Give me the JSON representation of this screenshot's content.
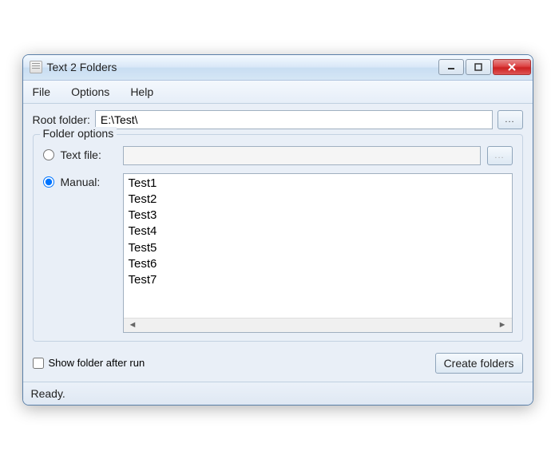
{
  "window": {
    "title": "Text 2 Folders"
  },
  "menu": {
    "file": "File",
    "options": "Options",
    "help": "Help"
  },
  "root": {
    "label": "Root folder:",
    "value": "E:\\Test\\",
    "browse": "..."
  },
  "group": {
    "title": "Folder options"
  },
  "textfile": {
    "label": "Text file:",
    "value": "",
    "browse": "..."
  },
  "manual": {
    "label": "Manual:",
    "value": "Test1\nTest2\nTest3\nTest4\nTest5\nTest6\nTest7"
  },
  "show_after": {
    "label": "Show folder after run"
  },
  "create": {
    "label": "Create folders"
  },
  "status": {
    "text": "Ready."
  }
}
